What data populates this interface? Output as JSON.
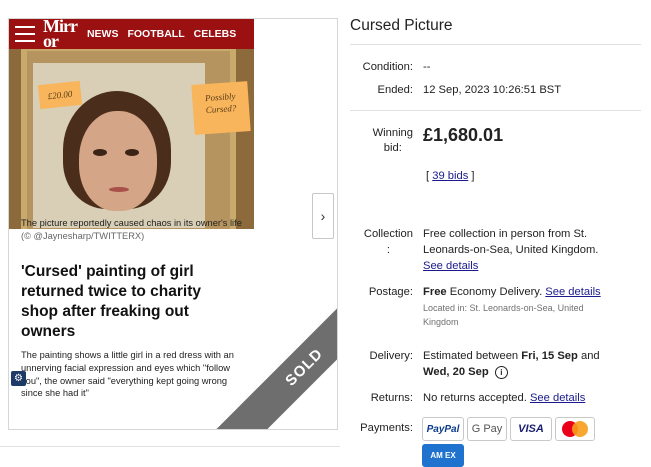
{
  "article": {
    "brand": "Mirror",
    "nav": [
      "NEWS",
      "FOOTBALL",
      "CELEBS"
    ],
    "sticky_price": "£20.00",
    "sticky_note": "Possibly Cursed?",
    "caption": "The picture reportedly caused chaos in its owner's life",
    "caption_credit": "(© @Jaynesharp/TWITTERX)",
    "headline": "'Cursed' painting of girl returned twice to charity shop after freaking out owners",
    "body": "The painting shows a little girl in a red dress with an unnerving facial expression and eyes which \"follow you\", the owner said \"everything kept going wrong since she had it\"",
    "sold_label": "SOLD"
  },
  "listing": {
    "title": "Cursed Picture",
    "condition_label": "Condition:",
    "condition_value": "--",
    "ended_label": "Ended:",
    "ended_value": "12 Sep, 2023 10:26:51 BST",
    "winning_bid_label_1": "Winning",
    "winning_bid_label_2": "bid:",
    "winning_bid_value": "£1,680.01",
    "bids_link": "39 bids",
    "collection_label_1": "Collection",
    "collection_label_2": ":",
    "collection_value_1": "Free collection in person from St.",
    "collection_value_2": "Leonards-on-Sea, United Kingdom.",
    "see_details": "See details",
    "postage_label": "Postage:",
    "postage_free": "Free",
    "postage_value": " Economy Delivery. ",
    "located_in_1": "Located in: St. Leonards-on-Sea, United",
    "located_in_2": "Kingdom",
    "delivery_label": "Delivery:",
    "delivery_value_1": "Estimated between ",
    "delivery_date_1": "Fri, 15 Sep",
    "delivery_and": " and",
    "delivery_date_2": "Wed, 20 Sep",
    "returns_label": "Returns:",
    "returns_value": "No returns accepted. ",
    "payments_label": "Payments:",
    "payments": [
      "PayPal",
      "G Pay",
      "VISA",
      "AM EX"
    ]
  }
}
